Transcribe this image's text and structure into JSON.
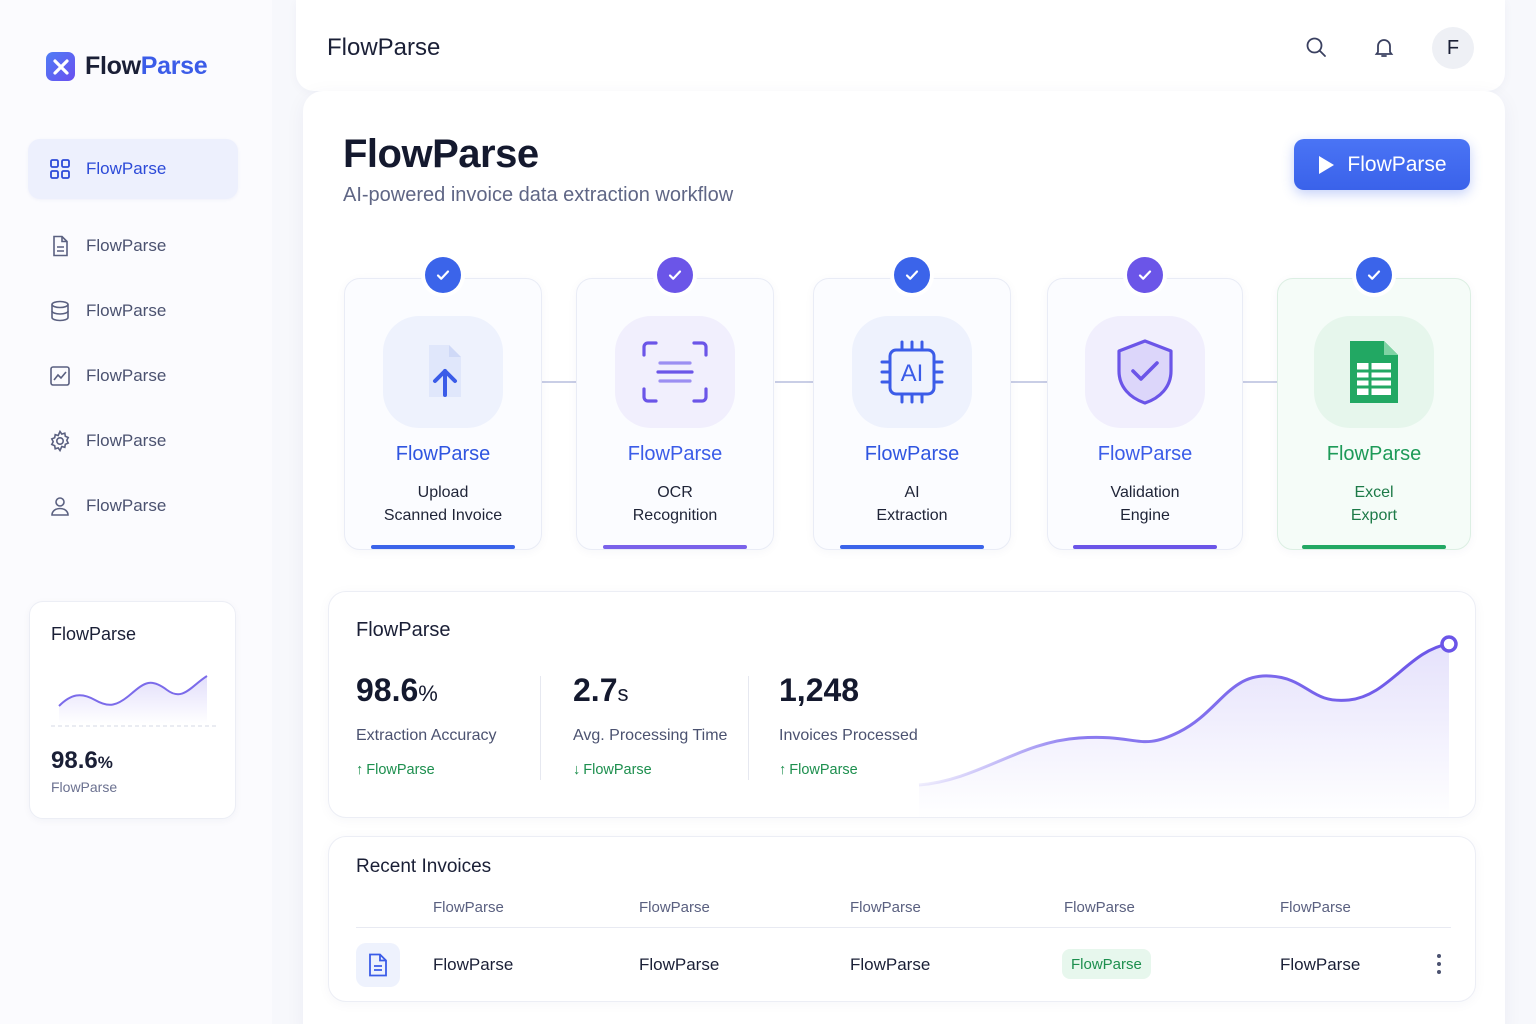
{
  "brand": {
    "name_part1": "Flow",
    "name_part2": "Parse"
  },
  "sidebar": {
    "items": [
      {
        "label": "FlowParse",
        "icon": "dashboard-grid-icon",
        "active": true
      },
      {
        "label": "FlowParse",
        "icon": "document-icon"
      },
      {
        "label": "FlowParse",
        "icon": "database-icon"
      },
      {
        "label": "FlowParse",
        "icon": "chart-icon"
      },
      {
        "label": "FlowParse",
        "icon": "gear-icon"
      },
      {
        "label": "FlowParse",
        "icon": "user-icon"
      }
    ],
    "mini_card": {
      "title": "FlowParse",
      "value": "98.6",
      "unit": "%",
      "sub": "FlowParse"
    }
  },
  "topbar": {
    "title": "FlowParse",
    "avatar_initial": "F"
  },
  "main": {
    "title": "FlowParse",
    "subtitle": "AI-powered invoice data extraction workflow",
    "primary_button": "FlowParse"
  },
  "workflow": [
    {
      "name": "FlowParse",
      "line1": "Upload",
      "line2": "Scanned Invoice",
      "color": "#3b5ce8",
      "icon": "upload-file-icon"
    },
    {
      "name": "FlowParse",
      "line1": "OCR",
      "line2": "Recognition",
      "color": "#6b55e8",
      "icon": "scan-icon"
    },
    {
      "name": "FlowParse",
      "line1": "AI",
      "line2": "Extraction",
      "color": "#3b5ce8",
      "icon": "ai-chip-icon"
    },
    {
      "name": "FlowParse",
      "line1": "Validation",
      "line2": "Engine",
      "color": "#6b55e8",
      "icon": "shield-check-icon"
    },
    {
      "name": "FlowParse",
      "line1": "Excel",
      "line2": "Export",
      "color": "#1d9a58",
      "icon": "spreadsheet-icon"
    }
  ],
  "stats": {
    "title": "FlowParse",
    "items": [
      {
        "value": "98.6",
        "unit": "%",
        "label": "Extraction Accuracy",
        "trend": "FlowParse",
        "trend_dir": "up"
      },
      {
        "value": "2.7",
        "unit": "s",
        "label": "Avg. Processing Time",
        "trend": "FlowParse",
        "trend_dir": "down"
      },
      {
        "value": "1,248",
        "unit": "",
        "label": "Invoices Processed",
        "trend": "FlowParse",
        "trend_dir": "up"
      }
    ]
  },
  "table": {
    "title": "Recent Invoices",
    "headers": [
      "FlowParse",
      "FlowParse",
      "FlowParse",
      "FlowParse",
      "FlowParse"
    ],
    "rows": [
      {
        "c1": "FlowParse",
        "c2": "FlowParse",
        "c3": "FlowParse",
        "status": "FlowParse",
        "c5": "FlowParse"
      }
    ]
  },
  "colors": {
    "accent": "#3b5ce8",
    "purple": "#6b55e8",
    "green": "#1d9a58"
  }
}
